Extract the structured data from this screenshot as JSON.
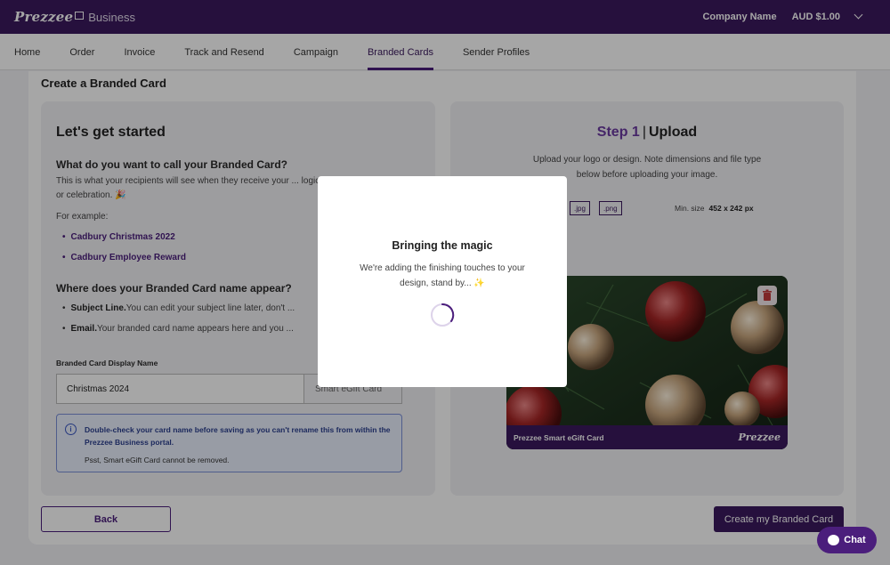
{
  "brand": {
    "logo": "Prezzee",
    "sub": "Business"
  },
  "topbar": {
    "company": "Company Name",
    "balance": "AUD $1.00"
  },
  "nav": [
    "Home",
    "Order",
    "Invoice",
    "Track and Resend",
    "Campaign",
    "Branded Cards",
    "Sender Profiles"
  ],
  "page": {
    "title": "Create a Branded Card"
  },
  "left": {
    "heading": "Let's get started",
    "q1": "What do you want to call your Branded Card?",
    "desc": "This is what your recipients will see when they receive your ... logical or fit for the occasion or celebration. 🎉",
    "for_example": "For example:",
    "examples": [
      "Cadbury Christmas 2022",
      "Cadbury Employee Reward"
    ],
    "q2": "Where does your Branded Card name appear?",
    "subject_bold": "Subject Line.",
    "subject_text": "You can edit your subject line later, don't ...",
    "email_bold": "Email.",
    "email_text": "Your branded card name appears here and you ...",
    "field_label": "Branded Card Display Name",
    "field_value": "Christmas 2024",
    "field_suffix": "Smart eGift Card",
    "info_bold": "Double-check your card name before saving as you can't rename this from within the Prezzee Business portal.",
    "info_note": "Psst, Smart eGift Card cannot be removed."
  },
  "right": {
    "step_num": "Step 1",
    "step_name": "Upload",
    "desc": "Upload your logo or design. Note dimensions and file type below before uploading your image.",
    "types": [
      ".jpg",
      ".png"
    ],
    "min_label": "Min. size",
    "min_value": "452 x 242 px",
    "card_label": "Prezzee Smart eGift Card",
    "card_logo": "Prezzee"
  },
  "buttons": {
    "back": "Back",
    "create": "Create my Branded Card",
    "chat": "Chat"
  },
  "modal": {
    "title": "Bringing the magic",
    "text": "We're adding the finishing touches to your design, stand by... ✨"
  }
}
